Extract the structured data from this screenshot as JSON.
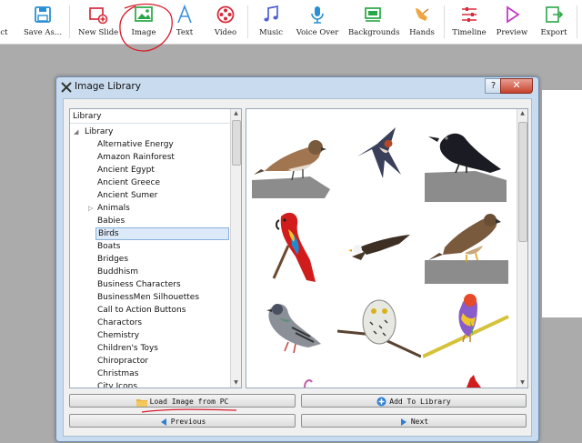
{
  "toolbar": {
    "items": [
      {
        "label": "ect",
        "icon": "select-icon"
      },
      {
        "label": "Save As...",
        "icon": "save-icon"
      },
      {
        "label": "New Slide",
        "icon": "new-slide-icon"
      },
      {
        "label": "Image",
        "icon": "image-icon"
      },
      {
        "label": "Text",
        "icon": "text-icon"
      },
      {
        "label": "Video",
        "icon": "video-icon"
      },
      {
        "label": "Music",
        "icon": "music-icon"
      },
      {
        "label": "Voice Over",
        "icon": "microphone-icon"
      },
      {
        "label": "Backgrounds",
        "icon": "backgrounds-icon"
      },
      {
        "label": "Hands",
        "icon": "hand-icon"
      },
      {
        "label": "Timeline",
        "icon": "timeline-icon"
      },
      {
        "label": "Preview",
        "icon": "play-icon"
      },
      {
        "label": "Export",
        "icon": "export-icon"
      }
    ]
  },
  "dialog": {
    "title": "Image Library",
    "help_label": "?",
    "close_label": "✕",
    "tree": {
      "header": "Library",
      "root": "Library",
      "items": [
        "Alternative Energy",
        "Amazon Rainforest",
        "Ancient Egypt",
        "Ancient Greece",
        "Ancient Sumer",
        "Animals",
        "Babies",
        "Birds",
        "Boats",
        "Bridges",
        "Buddhism",
        "Business Characters",
        "BusinessMen Silhouettes",
        "Call to Action Buttons",
        "Charactors",
        "Chemistry",
        "Children's Toys",
        "Chiropractor",
        "Christmas",
        "City Icons"
      ],
      "selected": "Birds"
    },
    "gallery": {
      "images": [
        "sparrow-image",
        "swallow-image",
        "crow-image",
        "macaw-image",
        "eagle-image",
        "hawk-image",
        "pigeon-image",
        "owl-image",
        "finch-image"
      ]
    },
    "buttons": {
      "load": "Load Image from PC",
      "add": "Add To Library",
      "previous": "Previous",
      "next": "Next"
    }
  },
  "colors": {
    "accent_red": "#d81c2c",
    "selection": "#dbe9f8",
    "dialog_frame": "#c9dbee"
  }
}
